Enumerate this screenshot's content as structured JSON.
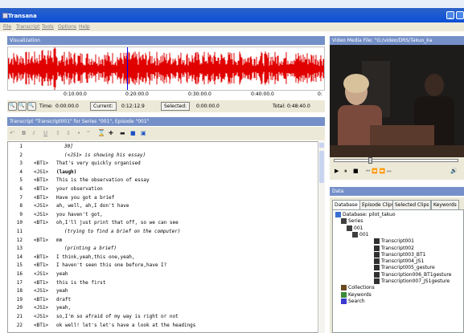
{
  "app": {
    "title": "Transana"
  },
  "menu": [
    "File",
    "Transcript",
    "Tools",
    "Options",
    "Help"
  ],
  "visualization": {
    "title": "Visualization",
    "ticks": [
      "0:10:00.0",
      "0:20:00.0",
      "0:30:00.0",
      "0:40:00.0",
      "0:"
    ],
    "time_label": "Time:",
    "time_value": "0:00:00.0",
    "current_label": "Current:",
    "current_value": "0:12:12.9",
    "selected_label": "Selected:",
    "selected_value": "0:00:00.0",
    "total": "Total: 0:48:40.0"
  },
  "transcript": {
    "title": "Transcript \"Transcript001\" for Series \"001\", Episode \"001\"",
    "toolbar": [
      "B",
      "I",
      "U"
    ],
    "lines": [
      {
        "n": "1",
        "s": "",
        "t": "30]"
      },
      {
        "n": "2",
        "s": "",
        "t": "(<JS1> is showing his essay)"
      },
      {
        "n": "3",
        "s": "<BT1>",
        "t": "That's very quickly organised"
      },
      {
        "n": "4",
        "s": "<JS1>",
        "t": "(laugh)"
      },
      {
        "n": "5",
        "s": "<BT1>",
        "t": "This is the observation of essay"
      },
      {
        "n": "6",
        "s": "<BT1>",
        "t": "your observation"
      },
      {
        "n": "7",
        "s": "<BT1>",
        "t": "Have you got a brief"
      },
      {
        "n": "8",
        "s": "<JS1>",
        "t": "ah, well, ah,I don't have"
      },
      {
        "n": "9",
        "s": "<JS1>",
        "t": "you haven't got,"
      },
      {
        "n": "10",
        "s": "<BT1>",
        "t": "oh,I'll just print that off, so we can see"
      },
      {
        "n": "11",
        "s": "",
        "t": "(trying to find a brief on the computer)"
      },
      {
        "n": "12",
        "s": "<BT1>",
        "t": "mm"
      },
      {
        "n": "13",
        "s": "",
        "t": "(printing a brief)"
      },
      {
        "n": "14",
        "s": "<BT1>",
        "t": "I think,yeah,this one,yeah,"
      },
      {
        "n": "15",
        "s": "<BT1>",
        "t": "I haven't seen this one before,have I?"
      },
      {
        "n": "16",
        "s": "<JS1>",
        "t": "yeah"
      },
      {
        "n": "17",
        "s": "<BT1>",
        "t": "this is the first"
      },
      {
        "n": "18",
        "s": "<JS1>",
        "t": "yeah"
      },
      {
        "n": "19",
        "s": "<BT1>",
        "t": "draft"
      },
      {
        "n": "20",
        "s": "<JS1>",
        "t": "yeah,"
      },
      {
        "n": "21",
        "s": "<JS1>",
        "t": "so,I'm so afraid of my way is right or not"
      },
      {
        "n": "22",
        "s": "<BT1>",
        "t": "ok well! let's let's have a look at the headings"
      }
    ]
  },
  "video": {
    "title": "Video Media File: \"G:/video/DRS/Takuo_ka"
  },
  "data": {
    "title": "Data",
    "tabs": [
      "Database",
      "Episode Clips",
      "Selected Clips",
      "Keywords"
    ],
    "tree": [
      "Database: pilot_takuo",
      "Series",
      "001",
      "001",
      "Transcript001",
      "Transcript002",
      "Transcript003_BT1",
      "Transcript004_JS1",
      "Transcript005_gesture",
      "Transcription006_BT1gesture",
      "Transcription007_JS1gesture",
      "Collections",
      "Keywords",
      "Search"
    ]
  }
}
